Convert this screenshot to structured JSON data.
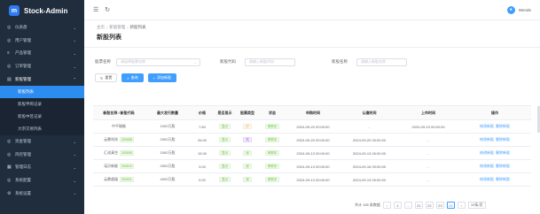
{
  "app": {
    "title": "Stock-Admin"
  },
  "header": {
    "user": "Wende"
  },
  "sidebar": {
    "items": [
      {
        "icon": "home-icon",
        "label": "仪表盘"
      },
      {
        "icon": "user-icon",
        "label": "用户管理"
      },
      {
        "icon": "product-icon",
        "label": "产品管理"
      },
      {
        "icon": "order-icon",
        "label": "订单管理"
      },
      {
        "icon": "stock-icon",
        "label": "新股管理",
        "open": true,
        "children": [
          "新股列表",
          "新股申购记录",
          "新股中签记录",
          "大宗交易列表"
        ],
        "active": 0
      },
      {
        "icon": "fund-icon",
        "label": "资金管理"
      },
      {
        "icon": "risk-icon",
        "label": "风控管理"
      },
      {
        "icon": "log-icon",
        "label": "管理日志"
      },
      {
        "icon": "config-icon",
        "label": "系统配置"
      },
      {
        "icon": "setting-icon",
        "label": "系统设置"
      }
    ]
  },
  "breadcrumb": [
    "主页",
    "新股管理",
    "新股列表"
  ],
  "page_title": "新股列表",
  "filters": [
    {
      "label": "股票名称",
      "placeholder": "请选择股票名称"
    },
    {
      "label": "新股代码",
      "placeholder": "请输入新股代码"
    },
    {
      "label": "新股名称",
      "placeholder": "请输入新股名称"
    }
  ],
  "actions": {
    "reset": "重置",
    "search": "查询",
    "add": "添加新股"
  },
  "table": {
    "columns": [
      "新股名称 / 新股代码",
      "最大发行数量",
      "价格",
      "是否显示",
      "股票类型",
      "状态",
      "申购时间",
      "认缴时间",
      "上市时间",
      "操作"
    ],
    "rows": [
      {
        "name": "中平磁能",
        "code": "",
        "qty": "1000万股",
        "price": "7.60",
        "show": "显示",
        "type": "沪",
        "type_color": "orange",
        "status": "申购中",
        "subscribe": "2024-09-20 00:00:00",
        "pay": "-",
        "list": "2024-09-19 00:00:00"
      },
      {
        "name": "云鼎科技",
        "code": "300688",
        "qty": "2000万股",
        "price": "26.00",
        "show": "显示",
        "type": "科",
        "type_color": "purple",
        "status": "申购中",
        "subscribe": "2024-09-20 00:00:00",
        "pay": "2024-09-20 00:00:00",
        "list": "-"
      },
      {
        "name": "汇成真空",
        "code": "300898",
        "qty": "1500万股",
        "price": "15.00",
        "show": "显示",
        "type": "深",
        "type_color": "green",
        "status": "申购中",
        "subscribe": "2024-09-13 00:00:00",
        "pay": "2024-09-13 00:00:00",
        "list": "-"
      },
      {
        "name": "诺贝新能",
        "code": "300819",
        "qty": "2500万股",
        "price": "3.00",
        "show": "显示",
        "type": "深",
        "type_color": "green",
        "status": "申购中",
        "subscribe": "2024-09-13 00:00:00",
        "pay": "2024-09-16 00:00:00",
        "list": "-"
      },
      {
        "name": "云鼎超级",
        "code": "300631",
        "qty": "4000万股",
        "price": "0.00",
        "show": "显示",
        "type": "深",
        "type_color": "green",
        "status": "申购中",
        "subscribe": "2024-09-13 00:00:00",
        "pay": "2024-09-13 00:00:00",
        "list": "-"
      }
    ],
    "op_edit": "修改新股",
    "op_delete": "删除新股"
  },
  "pagination": {
    "total": "共计 155 条数据",
    "pages": [
      "1",
      "...",
      "21",
      "22",
      "23",
      "24"
    ],
    "active": "24",
    "size": "10条/页"
  }
}
